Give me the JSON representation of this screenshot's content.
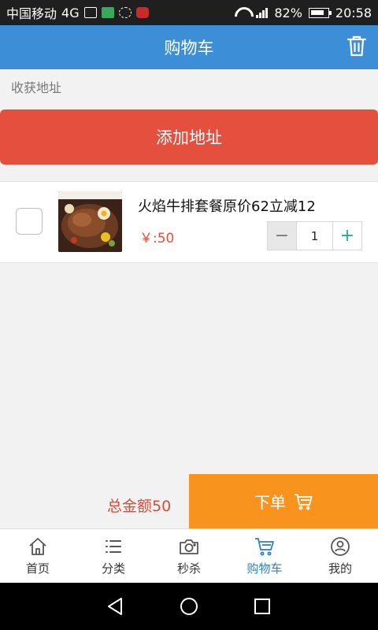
{
  "status_bar": {
    "carrier": "中国移动",
    "network": "4G",
    "battery": "82%",
    "time": "20:58",
    "icons": [
      "image-icon",
      "p-app-icon",
      "sync-icon",
      "weibo-icon",
      "wifi-icon",
      "signal-icon",
      "battery-icon"
    ]
  },
  "header": {
    "title": "购物车",
    "trash_icon": "trash-icon"
  },
  "address": {
    "label": "收获地址",
    "add_button": "添加地址"
  },
  "cart": {
    "items": [
      {
        "name": "火焰牛排套餐原价62立减12",
        "price": "￥:50",
        "quantity": "1",
        "checked": false
      }
    ]
  },
  "order": {
    "total": "总金额50",
    "button": "下单"
  },
  "tabs": [
    {
      "label": "首页",
      "icon": "home-icon",
      "active": false
    },
    {
      "label": "分类",
      "icon": "list-icon",
      "active": false
    },
    {
      "label": "秒杀",
      "icon": "camera-icon",
      "active": false
    },
    {
      "label": "购物车",
      "icon": "cart-icon",
      "active": true
    },
    {
      "label": "我的",
      "icon": "user-icon",
      "active": false
    }
  ],
  "colors": {
    "header": "#3c8fd7",
    "add_button": "#e5503e",
    "order_button": "#f8941d",
    "price": "#e5503e",
    "active_tab": "#2b7fc7"
  }
}
